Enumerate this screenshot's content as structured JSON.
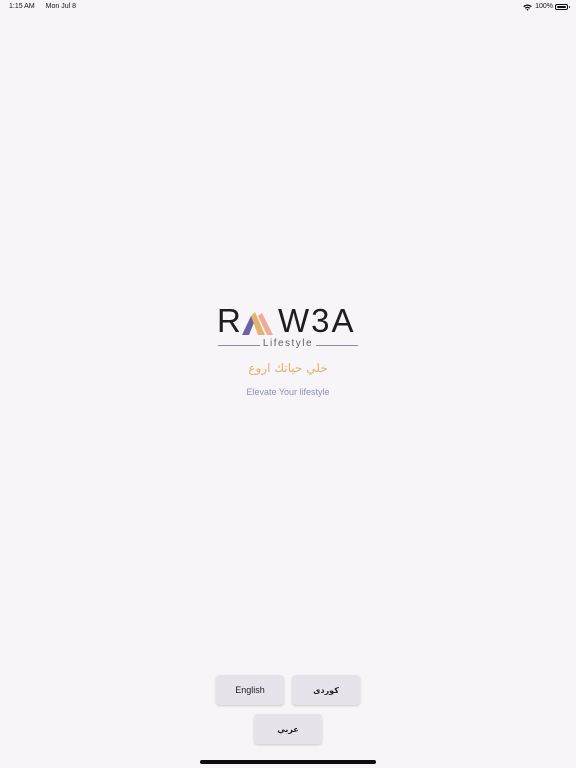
{
  "status_bar": {
    "time": "1:15 AM",
    "date": "Mon Jul 8",
    "battery_text": "100%",
    "battery_level": 1.0
  },
  "logo": {
    "wordmark_left": "R",
    "wordmark_right": "W3A",
    "tagline": "Lifestyle",
    "colors": {
      "purple": "#6d60a8",
      "gold": "#e3b36c",
      "peach": "#ee9c84",
      "dark": "#1d1d22"
    }
  },
  "slogan_ar": "خلي حياتك اروع",
  "slogan_en": "Elevate Your lifestyle",
  "language_buttons": {
    "english": "English",
    "kurdish": "كوردى",
    "arabic": "عربي"
  },
  "colors": {
    "background": "#f7f5f8",
    "button_bg": "#e6e4ea",
    "slogan_ar": "#e1b26f",
    "slogan_en": "#8f8fbe"
  }
}
